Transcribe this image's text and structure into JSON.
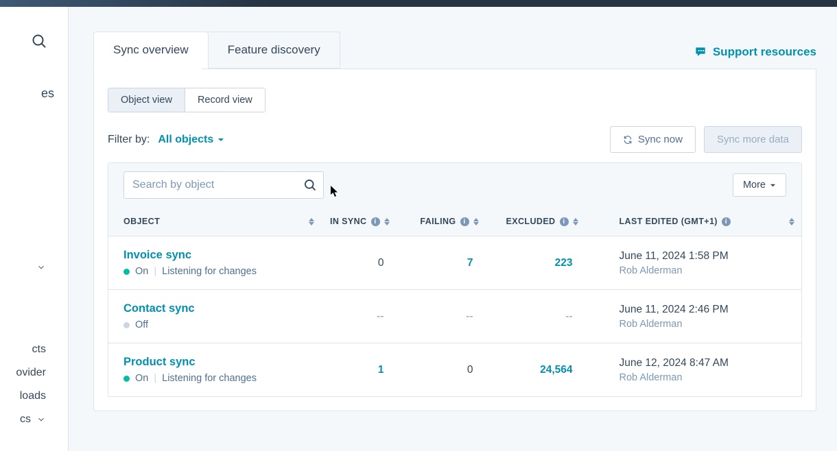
{
  "sidebar": {
    "top_fragment": "es",
    "items": [
      "cts",
      "ovider",
      "loads",
      "cs"
    ]
  },
  "tabs": {
    "sync_overview": "Sync overview",
    "feature_discovery": "Feature discovery"
  },
  "support_link": "Support resources",
  "view_toggle": {
    "object": "Object view",
    "record": "Record view"
  },
  "filter": {
    "label": "Filter by:",
    "value": "All objects"
  },
  "actions": {
    "sync_now": "Sync now",
    "sync_more": "Sync more data"
  },
  "search": {
    "placeholder": "Search by object"
  },
  "more_button": "More",
  "columns": {
    "object": "OBJECT",
    "in_sync": "IN SYNC",
    "failing": "FAILING",
    "excluded": "EXCLUDED",
    "last_edited": "LAST EDITED (GMT+1)"
  },
  "status_labels": {
    "on": "On",
    "off": "Off",
    "listening": "Listening for changes"
  },
  "rows": [
    {
      "name": "Invoice sync",
      "on": true,
      "in_sync": "0",
      "in_sync_link": false,
      "failing": "7",
      "failing_link": true,
      "excluded": "223",
      "excluded_link": true,
      "edited": "June 11, 2024 1:58 PM",
      "editor": "Rob Alderman"
    },
    {
      "name": "Contact sync",
      "on": false,
      "in_sync": "--",
      "failing": "--",
      "excluded": "--",
      "edited": "June 11, 2024 2:46 PM",
      "editor": "Rob Alderman"
    },
    {
      "name": "Product sync",
      "on": true,
      "in_sync": "1",
      "in_sync_link": true,
      "failing": "0",
      "failing_link": false,
      "excluded": "24,564",
      "excluded_link": true,
      "edited": "June 12, 2024 8:47 AM",
      "editor": "Rob Alderman"
    }
  ]
}
